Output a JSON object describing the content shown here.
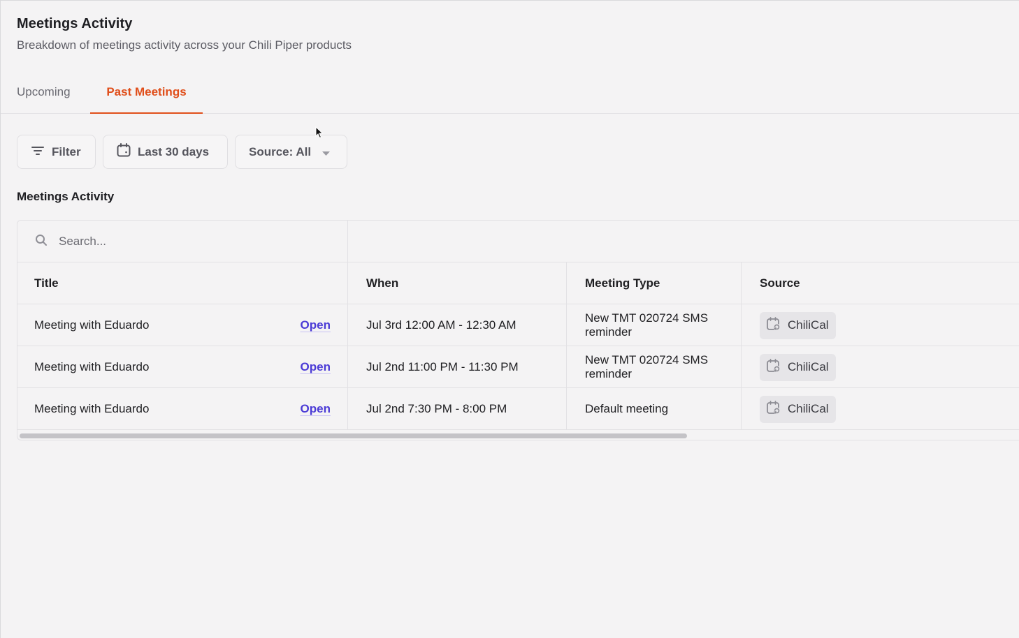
{
  "header": {
    "title": "Meetings Activity",
    "subtitle": "Breakdown of meetings activity across your Chili Piper products"
  },
  "tabs": [
    {
      "label": "Upcoming",
      "active": false
    },
    {
      "label": "Past Meetings",
      "active": true
    }
  ],
  "toolbar": {
    "filter_label": "Filter",
    "date_label": "Last 30 days",
    "source_label": "Source: All"
  },
  "section_title": "Meetings Activity",
  "search": {
    "placeholder": "Search...",
    "value": ""
  },
  "table": {
    "columns": [
      "Title",
      "When",
      "Meeting Type",
      "Source"
    ],
    "rows": [
      {
        "title": "Meeting with Eduardo",
        "action": "Open",
        "when": "Jul 3rd 12:00 AM - 12:30 AM",
        "meeting_type": "New TMT 020724 SMS reminder",
        "source": "ChiliCal"
      },
      {
        "title": "Meeting with Eduardo",
        "action": "Open",
        "when": "Jul 2nd 11:00 PM - 11:30 PM",
        "meeting_type": "New TMT 020724 SMS reminder",
        "source": "ChiliCal"
      },
      {
        "title": "Meeting with Eduardo",
        "action": "Open",
        "when": "Jul 2nd 7:30 PM - 8:00 PM",
        "meeting_type": "Default meeting",
        "source": "ChiliCal"
      }
    ]
  },
  "colors": {
    "accent": "#e04e1a",
    "link": "#4b3bd6",
    "background": "#f4f3f4"
  }
}
